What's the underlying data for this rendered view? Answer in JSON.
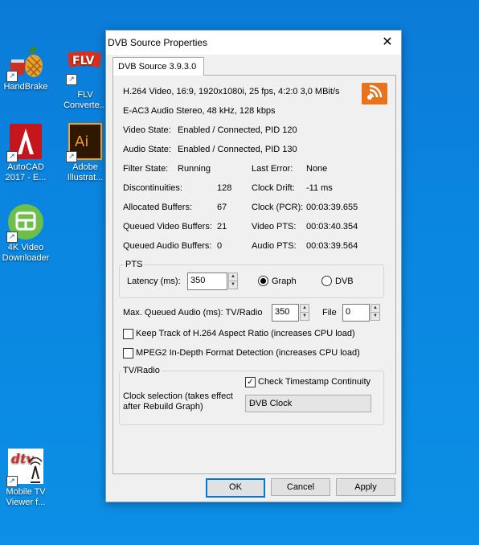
{
  "desktop": {
    "icons": [
      {
        "label": "HandBrake"
      },
      {
        "label": "FLV\nConverte..."
      },
      {
        "label": "AutoCAD\n2017 - E..."
      },
      {
        "label": "Adobe\nIllustrat..."
      },
      {
        "label": "4K Video\nDownloader"
      },
      {
        "label": "Mobile TV\nViewer f..."
      }
    ],
    "flv_badge": "FLV",
    "ai_badge": "Ai",
    "dtv_badge": "dtv"
  },
  "dialog": {
    "title": "DVB Source Properties",
    "close_glyph": "✕",
    "tab_label": "DVB Source 3.9.3.0",
    "video_info": "H.264 Video, 16:9, 1920x1080i, 25 fps, 4:2:0   3,0 MBit/s",
    "audio_info": "E-AC3 Audio Stereo, 48 kHz, 128 kbps",
    "video_state_label": "Video State:",
    "video_state_value": "Enabled / Connected, PID 120",
    "audio_state_label": "Audio State:",
    "audio_state_value": "Enabled / Connected, PID 130",
    "stats_left": [
      {
        "label": "Filter State:",
        "value": "Running"
      },
      {
        "label": "Discontinuities:",
        "value": "128"
      },
      {
        "label": "Allocated Buffers:",
        "value": "67"
      },
      {
        "label": "Queued Video Buffers:",
        "value": "21"
      },
      {
        "label": "Queued Audio Buffers:",
        "value": "0"
      }
    ],
    "stats_right": [
      {
        "label": "Last Error:",
        "value": "None"
      },
      {
        "label": "Clock Drift:",
        "value": "-11 ms"
      },
      {
        "label": "Clock (PCR):",
        "value": "00:03:39.655"
      },
      {
        "label": "Video PTS:",
        "value": "00:03:40.354"
      },
      {
        "label": "Audio PTS:",
        "value": "00:03:39.564"
      }
    ],
    "pts_group": {
      "title": "PTS",
      "latency_label": "Latency (ms):",
      "latency_value": "350",
      "graph_label": "Graph",
      "dvb_label": "DVB",
      "selected": "Graph"
    },
    "max_queued_label": "Max. Queued Audio (ms): TV/Radio",
    "max_queued_value": "350",
    "file_label": "File",
    "file_value": "0",
    "keep_track_label": "Keep Track of H.264 Aspect Ratio (increases CPU load)",
    "keep_track_checked": false,
    "mpeg2_label": "MPEG2 In-Depth Format Detection (increases CPU load)",
    "mpeg2_checked": false,
    "tvradio_group": {
      "title": "TV/Radio",
      "check_timestamp_label": "Check Timestamp Continuity",
      "check_timestamp_checked": true,
      "clock_label": "Clock selection (takes effect\nafter Rebuild Graph)",
      "clock_value": "DVB Clock"
    },
    "buttons": {
      "ok": "OK",
      "cancel": "Cancel",
      "apply": "Apply"
    }
  },
  "colors": {
    "desktop_bg": "#0a86e0",
    "accent": "#0078d7",
    "logo_orange": "#e8731c"
  }
}
